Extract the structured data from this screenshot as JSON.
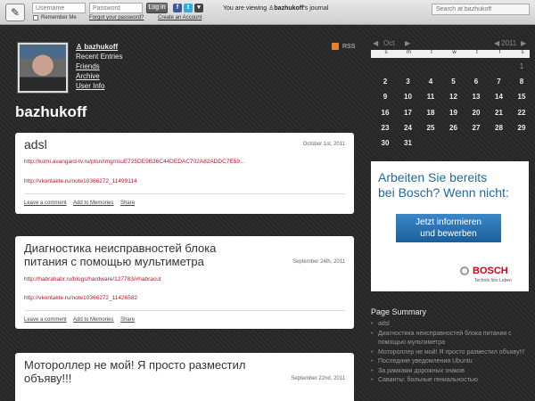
{
  "topbar": {
    "logo_glyph": "✎",
    "username_placeholder": "Username",
    "password_placeholder": "Password",
    "login_label": "Log in",
    "remember_me": "Remember Me",
    "forgot_password": "Forgot your password?",
    "create_account": "Create an Account",
    "viewing_prefix": "You are viewing",
    "viewing_user": "bazhukoff",
    "viewing_suffix": "'s journal",
    "search_placeholder": "Search at bazhukoff",
    "social_icons": [
      "facebook-icon",
      "twitter-icon",
      "dropdown-icon"
    ]
  },
  "profile": {
    "username": "bazhukoff",
    "links": [
      "Recent Entries",
      "Friends",
      "Archive",
      "User Info"
    ],
    "rss_label": "RSS",
    "journal_title": "bazhukoff"
  },
  "posts": [
    {
      "title": "adsl",
      "date": "October 1st, 2011",
      "links": [
        "http://komi.avangard-tv.ru/ptsn/img/risuE725DE9B36C44DEDAC702A82ADDC7E59...",
        "http://vkontakte.ru/note10366272_11499114"
      ],
      "actions": [
        "Leave a comment",
        "Add to Memories",
        "Share"
      ]
    },
    {
      "title_lines": [
        "Диагностика неисправностей блока",
        "питания с помощью мультиметра"
      ],
      "date": "September 24th, 2011",
      "links": [
        "http://habrahabr.ru/blogs/hardware/127783/#habracut",
        "http://vkontakte.ru/note10366272_11426582"
      ],
      "actions": [
        "Leave a comment",
        "Add to Memories",
        "Share"
      ]
    },
    {
      "title_lines": [
        "Мотороллер не мой! Я просто разместил",
        "объяву!!!"
      ],
      "date": "September 22nd, 2011"
    }
  ],
  "calendar": {
    "month": "Oct",
    "year": "2011",
    "prev_glyph": "◀",
    "next_glyph": "▶",
    "weekdays": [
      "s",
      "m",
      "t",
      "w",
      "t",
      "f",
      "s"
    ],
    "weeks": [
      [
        "",
        "",
        "",
        "",
        "",
        "",
        "1"
      ],
      [
        "2",
        "3",
        "4",
        "5",
        "6",
        "7",
        "8"
      ],
      [
        "9",
        "10",
        "11",
        "12",
        "13",
        "14",
        "15"
      ],
      [
        "16",
        "17",
        "18",
        "19",
        "20",
        "21",
        "22"
      ],
      [
        "23",
        "24",
        "25",
        "26",
        "27",
        "28",
        "29"
      ],
      [
        "30",
        "31",
        "",
        "",
        "",
        "",
        ""
      ]
    ]
  },
  "ad": {
    "headline_lines": [
      "Arbeiten Sie bereits",
      "bei Bosch? Wenn nicht:"
    ],
    "button_lines": [
      "Jetzt informieren",
      "und bewerben"
    ],
    "brand": "BOSCH",
    "tagline": "Technik fürs Leben"
  },
  "summary": {
    "title": "Page Summary",
    "items": [
      "adsl",
      "Диагностика неисправностей блока питания с помощью мультиметра",
      "Мотороллер не мой! Я просто разместил объяву!!!",
      "Последние уведомления Ubuntu",
      "За рамками дорожных знаков",
      "Саванты: больные гениальностью"
    ]
  }
}
